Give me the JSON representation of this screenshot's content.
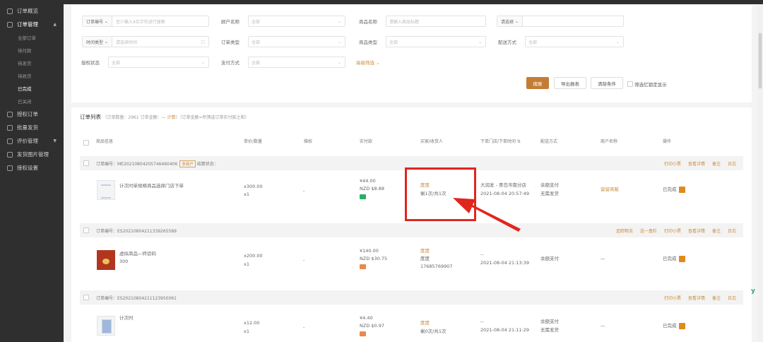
{
  "sidebar": {
    "items": [
      {
        "label": "订单概览"
      },
      {
        "label": "订单管理",
        "expanded": true
      },
      {
        "label": "授权订单"
      },
      {
        "label": "批量发货"
      },
      {
        "label": "评价管理"
      },
      {
        "label": "发货图片管理"
      },
      {
        "label": "接权设置"
      }
    ],
    "sub_items": [
      "全部订单",
      "待付款",
      "待发货",
      "待收货",
      "已完成",
      "已关闭"
    ],
    "current_sub": "已完成"
  },
  "filters": {
    "order_no_select": "订单编号",
    "order_no_placeholder": "至少输入4位字符进行搜索",
    "customer_label": "顾户名称",
    "customer_value": "全部",
    "product_name_label": "商品名称",
    "product_name_placeholder": "请输入商品标题",
    "product_select_placeholder": "请选择",
    "time_type_select": "时间类型",
    "time_placeholder": "请选择时间",
    "order_type_label": "订单类型",
    "order_type_value": "全部",
    "product_type_label": "商品类型",
    "product_type_value": "全部",
    "delivery_label": "配送方式",
    "delivery_value": "全部",
    "auth_status_label": "授权状态",
    "auth_status_value": "全部",
    "pay_method_label": "支付方式",
    "pay_method_value": "全部",
    "more_filters": "高级筛选 ⌄",
    "search_button": "搜索",
    "export_button": "导出报表",
    "clear_button": "清除条件",
    "hide_label": "筛选忆锁定显示"
  },
  "list": {
    "title": "订单列表",
    "summary_prefix": "（订单数量：2961 订单金额：",
    "summary_em": "— 计算",
    "summary_suffix": "）（订单金额=所筛选订单实付款之和）",
    "columns": {
      "product": "商品信息",
      "price_qty": "单价/数量",
      "rights": "维权",
      "paid": "实付款",
      "buyer": "买家/收货人",
      "store_time": "下单门店/下单时间 ⇅",
      "delivery": "配送方式",
      "customer": "商户名称",
      "actions": "操作"
    },
    "orders": [
      {
        "order_no": "订单编号：ME20210804205746460406",
        "tag": "多商户",
        "status_text": "结算状态：",
        "ops": [
          "打印小票",
          "查看详情",
          "备注",
          "日志"
        ],
        "product_title": "计次时单规格商品选择门店下单",
        "price": "x300.00",
        "qty": "x1",
        "rights": "-",
        "paid": "¥44.00",
        "paid_nzd": "NZD $8.88",
        "pay_icon": "wechat-pay-icon",
        "buyer": "度度",
        "buyer_sub": "剩1次/共1次",
        "store": "大润发 - 青岛市南分店",
        "time": "2021-08-04 20:57:49",
        "delivery": "余额支付",
        "delivery_sub": "无需发货",
        "customer": "留留商贩",
        "status": "已完成"
      },
      {
        "order_no": "订单编号：ES20210804211339265589",
        "ops": [
          "追踪物流",
          "送一盒阶",
          "打印小票",
          "查看详情",
          "备注",
          "日志"
        ],
        "product_title": "虚拟商品—终验码",
        "product_sub": "300",
        "price": "x200.00",
        "qty": "x1",
        "rights": "-",
        "paid": "¥140.00",
        "paid_nzd": "NZD $30.75",
        "pay_icon": "balance-pay-icon",
        "buyer": "度度",
        "buyer_sub": "度度",
        "buyer_phone": "17685769907",
        "store": "--",
        "time": "2021-08-04 21:13:39",
        "delivery": "余额支付",
        "customer": "—",
        "status": "已完成"
      },
      {
        "order_no": "订单编号：ES20210804211123950061",
        "ops": [
          "打印小票",
          "查看详情",
          "备注",
          "日志"
        ],
        "product_title": "计次时",
        "price": "x12.00",
        "qty": "x1",
        "rights": "-",
        "paid": "¥4.40",
        "paid_nzd": "NZD $0.97",
        "pay_icon": "balance-pay-icon",
        "buyer": "度度",
        "buyer_sub": "剩0次/共1次",
        "store": "--",
        "time": "2021-08-04 21:11:29",
        "delivery": "余额支付",
        "delivery_sub": "无需发货",
        "customer": "—",
        "status": "已完成"
      }
    ]
  },
  "colors": {
    "accent": "#c47c34",
    "highlight": "#e0261f",
    "sidebar_bg": "#2f2f2f"
  },
  "floating_mark": "y"
}
